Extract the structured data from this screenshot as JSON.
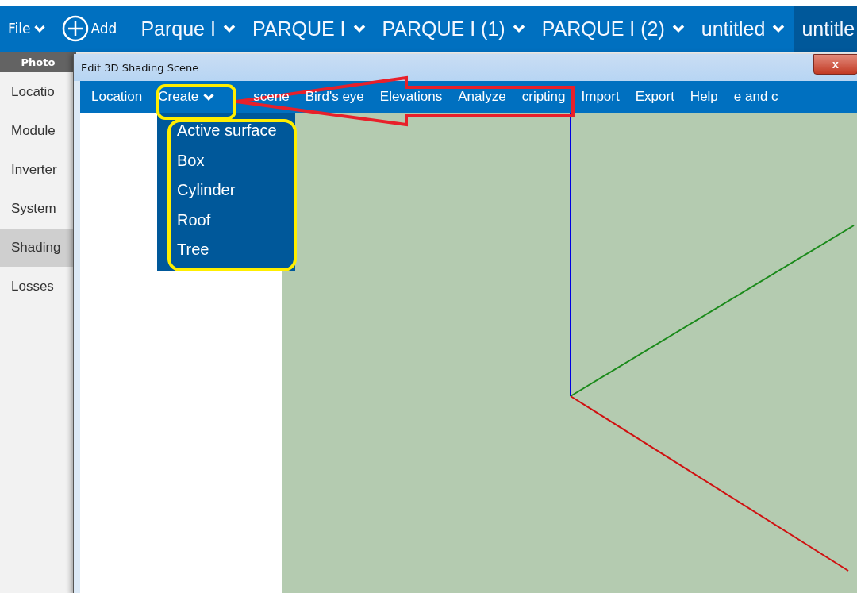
{
  "top_bar": {
    "file_menu": "File",
    "add_button": "Add",
    "tabs": [
      {
        "label": "Parque I",
        "selected": false
      },
      {
        "label": "PARQUE I",
        "selected": false
      },
      {
        "label": "PARQUE I (1)",
        "selected": false
      },
      {
        "label": "PARQUE I (2)",
        "selected": false
      },
      {
        "label": "untitled",
        "selected": false
      },
      {
        "label": "untitle",
        "selected": true
      }
    ]
  },
  "sub_bar": {
    "title": "Photo"
  },
  "sidebar": {
    "items": [
      {
        "label": "Locatio",
        "selected": false
      },
      {
        "label": "Module",
        "selected": false
      },
      {
        "label": "Inverter",
        "selected": false
      },
      {
        "label": "System",
        "selected": false
      },
      {
        "label": "Shading",
        "selected": true
      },
      {
        "label": "Losses",
        "selected": false
      }
    ]
  },
  "dialog": {
    "title": "Edit 3D Shading Scene",
    "close": "x",
    "menu": [
      {
        "label": "Location",
        "expanded": false
      },
      {
        "label": "Create",
        "expanded": true
      },
      {
        "label": "scene",
        "expanded": false
      },
      {
        "label": "Bird's eye",
        "expanded": false
      },
      {
        "label": "Elevations",
        "expanded": false
      },
      {
        "label": "Analyze",
        "expanded": false
      },
      {
        "label": "cripting",
        "expanded": false
      },
      {
        "label": "Import",
        "expanded": false
      },
      {
        "label": "Export",
        "expanded": false
      },
      {
        "label": "Help",
        "expanded": false
      },
      {
        "label": "e and c",
        "expanded": false
      }
    ],
    "dropdown": [
      "Active surface",
      "Box",
      "Cylinder",
      "Roof",
      "Tree"
    ]
  }
}
